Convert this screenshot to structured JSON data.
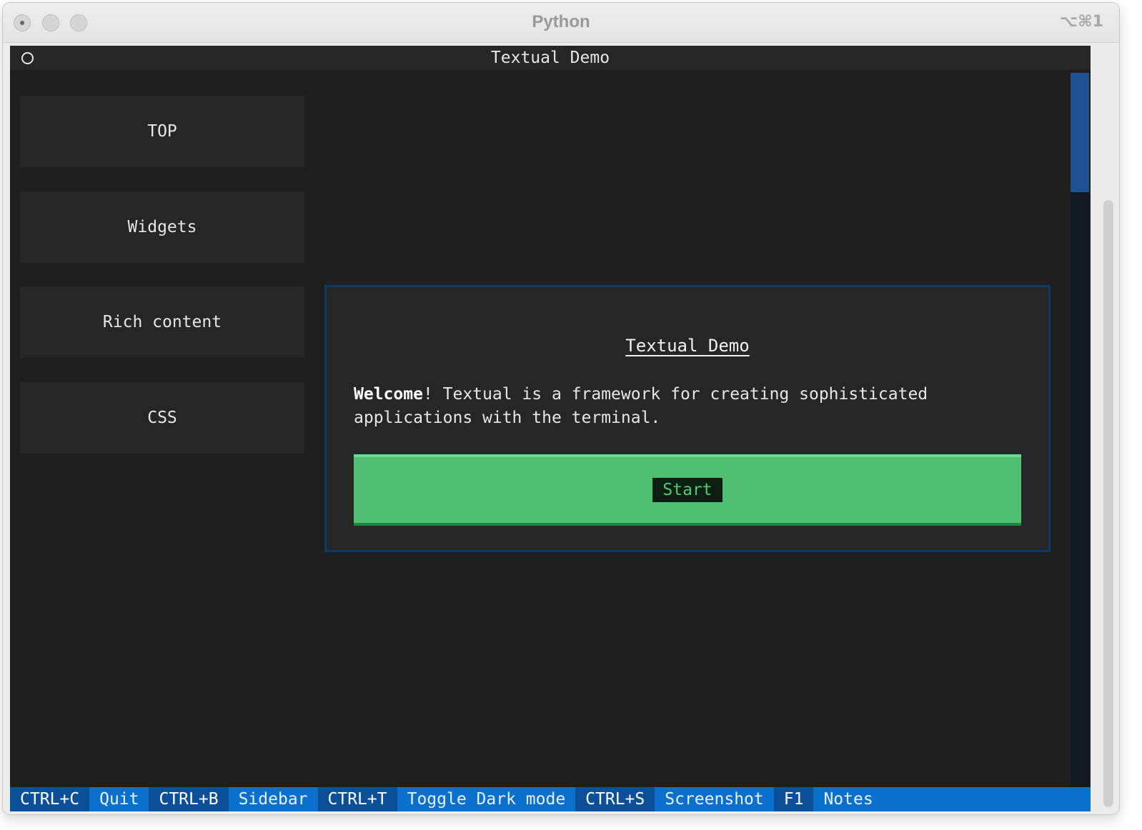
{
  "window": {
    "title": "Python",
    "shortcut": "⌥⌘1"
  },
  "app": {
    "header_title": "Textual Demo"
  },
  "sidebar": {
    "items": [
      {
        "label": "TOP"
      },
      {
        "label": "Widgets"
      },
      {
        "label": "Rich content"
      },
      {
        "label": "CSS"
      }
    ]
  },
  "card": {
    "title": "Textual Demo",
    "welcome_bold": "Welcome",
    "welcome_rest": "! Textual is a framework for creating sophisticated applications with the terminal.",
    "start_label": "Start"
  },
  "footer": {
    "bindings": [
      {
        "key": "CTRL+C",
        "desc": "Quit"
      },
      {
        "key": "CTRL+B",
        "desc": "Sidebar"
      },
      {
        "key": "CTRL+T",
        "desc": "Toggle Dark mode"
      },
      {
        "key": "CTRL+S",
        "desc": "Screenshot"
      },
      {
        "key": "F1",
        "desc": "Notes"
      }
    ]
  },
  "colors": {
    "background": "#1e1e1e",
    "panel": "#262626",
    "accent_green": "#50bf72",
    "card_border": "#0c3a66",
    "footer_bg": "#0a70cc",
    "footer_key_bg": "#0b4f99"
  }
}
